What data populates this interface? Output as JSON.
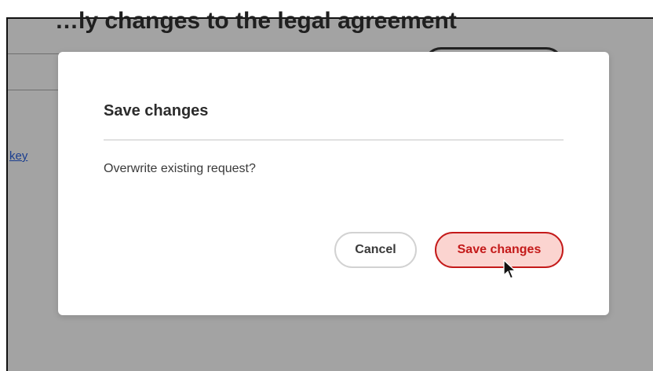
{
  "background": {
    "top_cut_text": "…ly changes to the legal agreement",
    "link_text": "key"
  },
  "dialog": {
    "title": "Save changes",
    "message": "Overwrite existing request?",
    "cancel_label": "Cancel",
    "save_label": "Save changes"
  },
  "colors": {
    "overlay": "#a3a3a3",
    "save_fill": "#fbd4d0",
    "save_border": "#c41a1a",
    "cancel_border": "#d2d2d2"
  },
  "cursor": {
    "icon": "arrow-cursor-icon"
  }
}
